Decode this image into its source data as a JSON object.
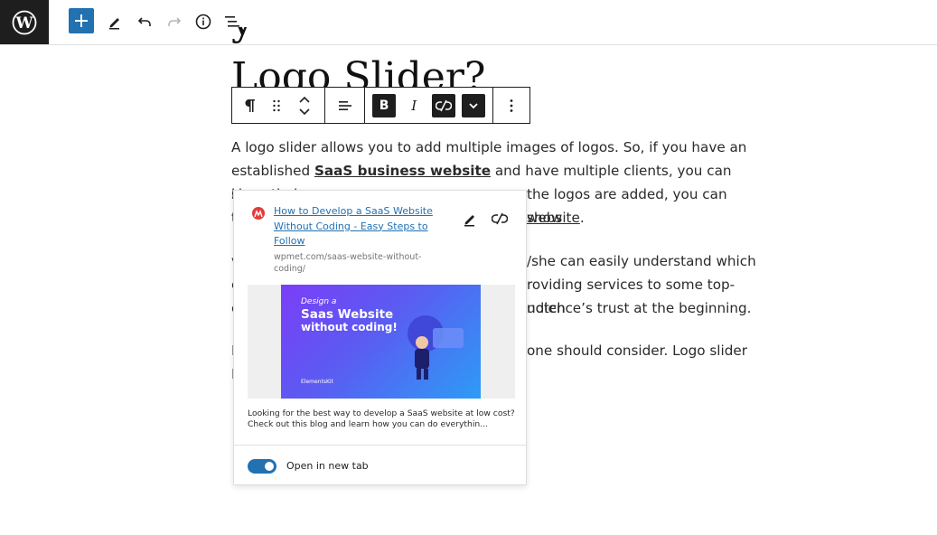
{
  "heading": {
    "title": "Logo Slider?"
  },
  "paragraphs": {
    "p1_before": "A logo slider allows you to add multiple images of logos. So, if you have an established ",
    "p1_link": "SaaS business website",
    "p1_after": " and have multiple clients, you can show their",
    "p1_line3_left": "l",
    "p1_line3_right": "the logos are added, you can show",
    "p1_line4_left": "t",
    "p1_line4_link": "website",
    "p1_line4_end": ".",
    "p2_l1": "/she can easily understand which",
    "p2_l2": "roviding services to some top-notch",
    "p2_l3": "udience’s trust at the beginning.",
    "p2_start1": "v",
    "p2_start2": "c",
    "p2_start3": "c",
    "p3_l1": "one should consider. Logo slider",
    "p3_start1": "I",
    "p3_start2": "I"
  },
  "popover": {
    "title": "How to Develop a SaaS Website Without Coding - Easy Steps to Follow",
    "url": "wpmet.com/saas-website-without-coding/",
    "preview": {
      "small_text": "Design a",
      "big_text_1": "Saas Website",
      "big_text_2": "without coding!",
      "brand": "ElementsKit"
    },
    "description": "Looking for the best way to develop a SaaS website at low cost? Check out this blog and learn how you can do everythin...",
    "toggle_label": "Open in new tab",
    "toggle_on": true
  },
  "colors": {
    "accent": "#2271b1",
    "dark": "#1e1e1e"
  }
}
